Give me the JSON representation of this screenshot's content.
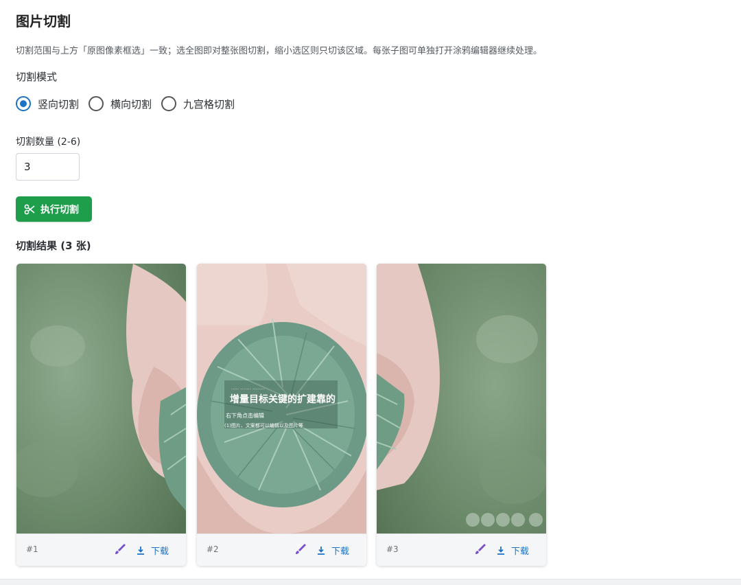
{
  "page": {
    "title": "图片切割",
    "description": "切割范围与上方「原图像素框选」一致；选全图即对整张图切割，缩小选区则只切该区域。每张子图可单独打开涂鸦编辑器继续处理。",
    "mode_label": "切割模式",
    "modes": [
      {
        "label": "竖向切割",
        "checked": true
      },
      {
        "label": "横向切割",
        "checked": false
      },
      {
        "label": "九宫格切割",
        "checked": false
      }
    ],
    "count_label": "切割数量 (2-6)",
    "count_value": "3",
    "execute_label": "执行切割",
    "result_label": "切割结果 (3 张)"
  },
  "results": [
    {
      "index": "#1",
      "download_label": "下载",
      "icon": "brush-icon"
    },
    {
      "index": "#2",
      "download_label": "下载",
      "icon": "brush-icon"
    },
    {
      "index": "#3",
      "download_label": "下载",
      "icon": "brush-icon"
    }
  ],
  "overlay_text": {
    "headline": "增量目标关键的扩建靠的",
    "line1": "右下角点击编辑",
    "line2": "(1)图片、文案都可以编辑以及图片等"
  },
  "colors": {
    "accent": "#1a73c7",
    "execute_button": "#1e9e4a",
    "edit_icon": "#7b4fc9"
  }
}
